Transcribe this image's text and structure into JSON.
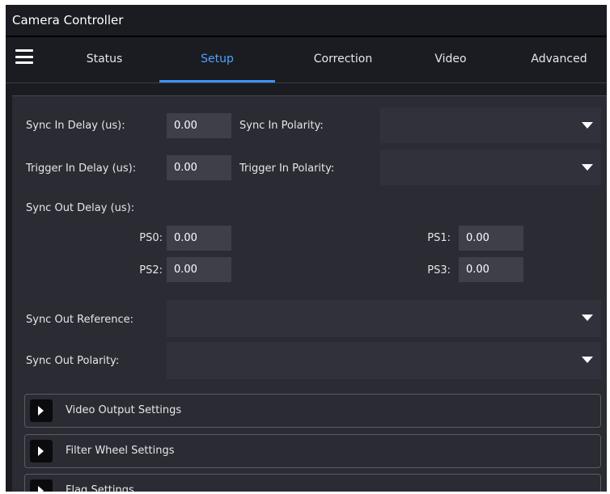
{
  "window": {
    "title": "Camera Controller"
  },
  "nav": {
    "tabs": [
      "Status",
      "Setup",
      "Correction",
      "Video",
      "Advanced"
    ],
    "active": "Setup",
    "accent_color": "#3e94f5"
  },
  "setup": {
    "sync_in_delay": {
      "label": "Sync In Delay (us):",
      "value": "0.00"
    },
    "sync_in_polarity": {
      "label": "Sync In Polarity:",
      "value": ""
    },
    "trigger_in_delay": {
      "label": "Trigger In Delay (us):",
      "value": "0.00"
    },
    "trigger_in_polarity": {
      "label": "Trigger In Polarity:",
      "value": ""
    },
    "sync_out_delay": {
      "label": "Sync Out Delay (us):",
      "ps0": {
        "label": "PS0:",
        "value": "0.00"
      },
      "ps1": {
        "label": "PS1:",
        "value": "0.00"
      },
      "ps2": {
        "label": "PS2:",
        "value": "0.00"
      },
      "ps3": {
        "label": "PS3:",
        "value": "0.00"
      }
    },
    "sync_out_reference": {
      "label": "Sync Out Reference:",
      "value": ""
    },
    "sync_out_polarity": {
      "label": "Sync Out Polarity:",
      "value": ""
    }
  },
  "sections": [
    {
      "label": "Video Output Settings",
      "icon": "triangle-right-icon"
    },
    {
      "label": "Filter Wheel Settings",
      "icon": "triangle-right-icon"
    },
    {
      "label": "Flag Settings",
      "icon": "triangle-right-icon"
    }
  ]
}
